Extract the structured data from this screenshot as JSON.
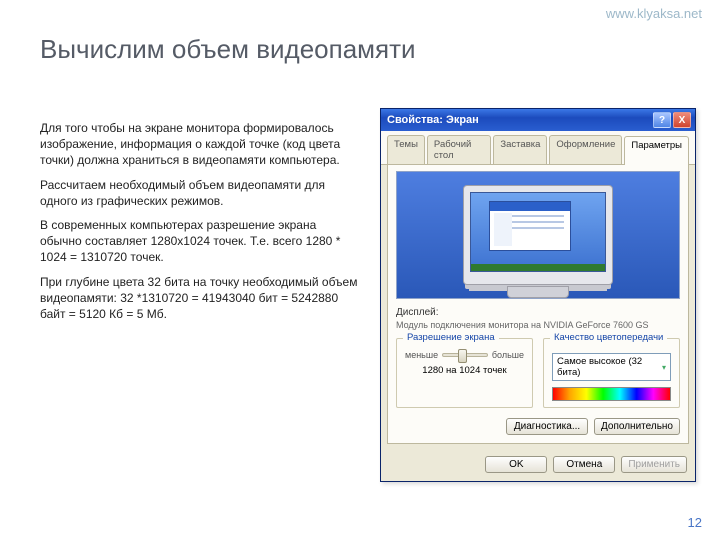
{
  "watermark": "www.klyaksa.net",
  "title": "Вычислим объем видеопамяти",
  "paragraphs": {
    "p1": "Для того чтобы на экране монитора формировалось изображение, информация о каждой точке (код цвета точки) должна храниться в видеопамяти компьютера.",
    "p2": "Рассчитаем необходимый объем видеопамяти для одного из графических режимов.",
    "p3": "В современных компьютерах разрешение экрана обычно составляет 1280х1024 точек. Т.е. всего 1280 * 1024 = 1310720 точек.",
    "p4": "При глубине цвета 32 бита на точку необходимый объем видеопамяти: 32 *1310720 = 41943040 бит = 5242880 байт = 5120 Кб = 5 Мб."
  },
  "page_number": "12",
  "dialog": {
    "title": "Свойства: Экран",
    "help_icon": "?",
    "close_icon": "X",
    "tabs": [
      "Темы",
      "Рабочий стол",
      "Заставка",
      "Оформление",
      "Параметры"
    ],
    "active_tab_idx": 4,
    "display_label": "Дисплей:",
    "display_desc": "Модуль подключения монитора на NVIDIA GeForce 7600 GS",
    "group_resolution": {
      "legend": "Разрешение экрана",
      "min": "меньше",
      "max": "больше",
      "value": "1280 на 1024 точек"
    },
    "group_color": {
      "legend": "Качество цветопередачи",
      "selected": "Самое высокое (32 бита)"
    },
    "buttons": {
      "diag": "Диагностика...",
      "adv": "Дополнительно",
      "ok": "OK",
      "cancel": "Отмена",
      "apply": "Применить"
    }
  }
}
